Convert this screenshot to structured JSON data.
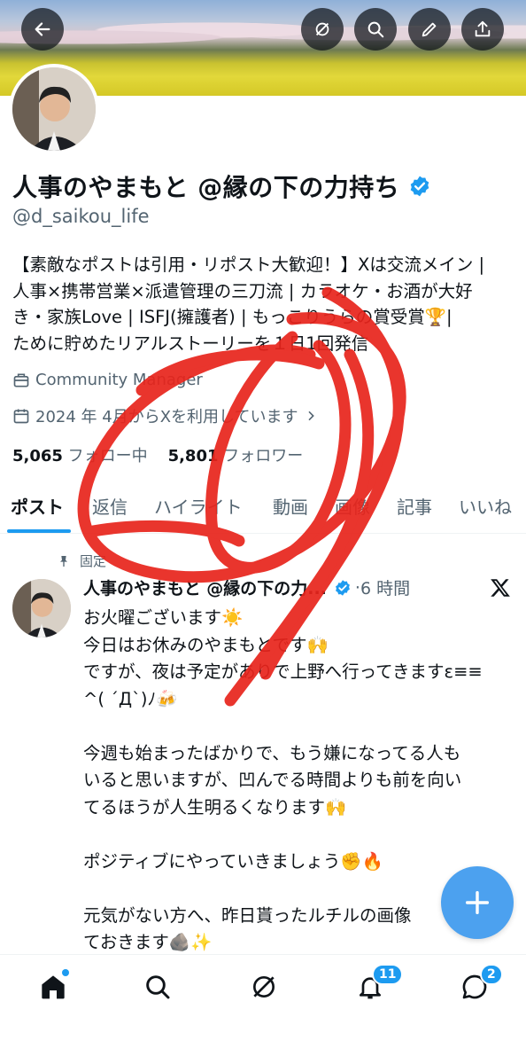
{
  "header": {
    "back_icon": "arrow-left-icon",
    "actions": [
      "grok-icon",
      "search-icon",
      "edit-icon",
      "share-icon"
    ]
  },
  "profile": {
    "name": "人事のやまもと @縁の下の力持ち",
    "handle": "@d_saikou_life",
    "bio_lines": [
      "【素敵なポストは引用・リポスト大歓迎！】Xは交流メイン |",
      "人事×携帯営業×派遣管理の三刀流 | カラオケ・お酒が大好",
      "き・家族Love | ISFJ(擁護者) | もっこりうらの賞受賞🏆|",
      "ために貯めたリアルストーリーを１日1回発信"
    ],
    "job": "Community Manager",
    "joined": "2024 年 4月からXを利用しています",
    "following_count": "5,065",
    "following_label": "フォロー中",
    "followers_count": "5,801",
    "followers_label": "フォロワー"
  },
  "tabs": [
    "ポスト",
    "返信",
    "ハイライト",
    "動画",
    "画像",
    "記事",
    "いいね"
  ],
  "pinned_post": {
    "pinned_label": "固定",
    "author": "人事のやまもと @縁の下の力...",
    "time": "6 時間",
    "body": "お火曜ございます☀️\n今日はお休みのやまもとです🙌\nですが、夜は予定がありで上野へ行ってきますε≡≡\n^( ´Д`)ﾉ🍻\n\n今週も始まったばかりで、もう嫌になってる人も\nいると思いますが、凹んでる時間よりも前を向い\nてるほうが人生明るくなります🙌\n\nポジティブにやっていきましょう✊🔥\n\n元気がない方へ、昨日貰ったルチルの画像\nておきます🪨✨\nげんきになぁ〜れ ✨✨"
  },
  "bottom_nav": {
    "items": [
      "home-icon",
      "search-icon",
      "grok-icon",
      "notifications-icon",
      "messages-icon"
    ],
    "notifications_badge": "11",
    "messages_badge": "2"
  },
  "colors": {
    "accent": "#1d9bf0",
    "fab": "#4ca1ef",
    "scribble": "#e8241c"
  }
}
